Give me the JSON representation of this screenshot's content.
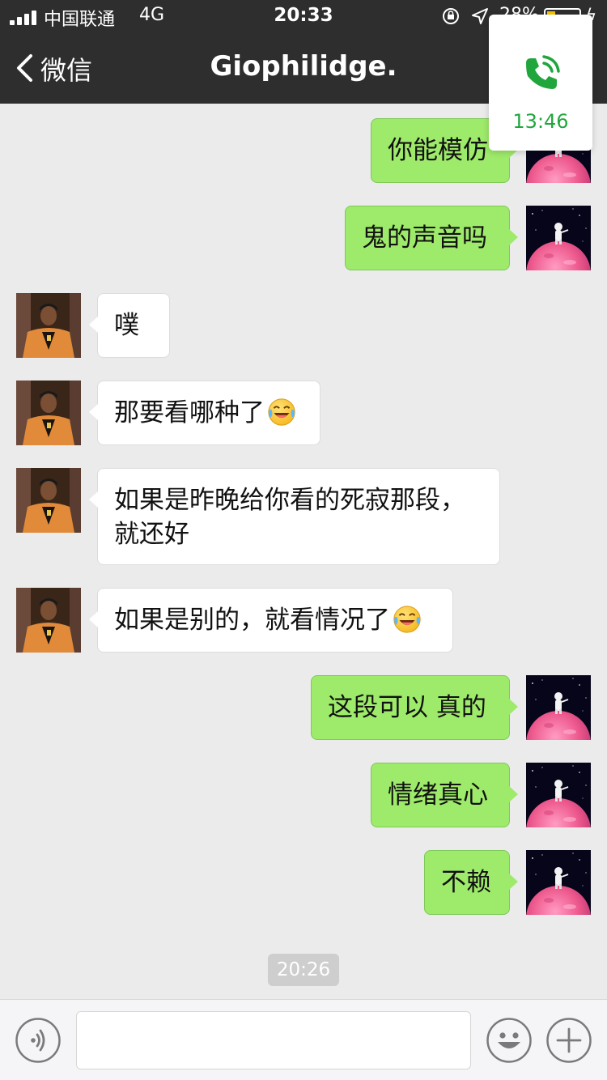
{
  "status_bar": {
    "carrier": "中国联通",
    "network": "4G",
    "time": "20:33",
    "battery_percent": "28%"
  },
  "nav": {
    "back_label": "微信",
    "title": "Giophilidge."
  },
  "call_float": {
    "duration": "13:46",
    "icon": "phone-icon",
    "color": "#21a63e"
  },
  "messages": [
    {
      "sender": "me",
      "text": "你能模仿"
    },
    {
      "sender": "me",
      "text": "鬼的声音吗"
    },
    {
      "sender": "other",
      "text": "噗"
    },
    {
      "sender": "other",
      "text": "那要看哪种了",
      "emoji": "face-with-tears-of-joy"
    },
    {
      "sender": "other",
      "text": "如果是昨晚给你看的死寂那段，",
      "text_line2": "就还好"
    },
    {
      "sender": "other",
      "text": "如果是别的，就看情况了",
      "emoji": "face-with-tears-of-joy"
    },
    {
      "sender": "me",
      "text": "这段可以 真的"
    },
    {
      "sender": "me",
      "text": "情绪真心"
    },
    {
      "sender": "me",
      "text": "不赖"
    }
  ],
  "timestamp": "20:26",
  "input_bar": {
    "voice_icon": "voice-icon",
    "emoji_icon": "smiley-icon",
    "plus_icon": "plus-icon",
    "placeholder": ""
  },
  "colors": {
    "nav_bg": "#2e2e2f",
    "chat_bg": "#ebebeb",
    "my_bubble": "#9eea6a",
    "their_bubble": "#ffffff"
  }
}
